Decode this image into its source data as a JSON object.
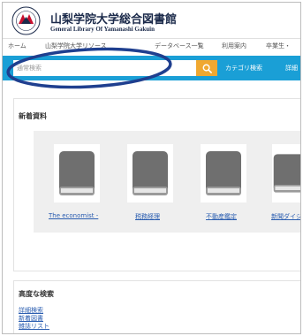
{
  "header": {
    "title_jp": "山梨学院大学総合図書館",
    "title_en": "General Library Of Yamanashi Gakuin"
  },
  "nav": {
    "items": [
      {
        "label": "ホーム"
      },
      {
        "label": "山梨学院大学リソース"
      },
      {
        "label": "データベース一覧"
      },
      {
        "label": "利用案内"
      },
      {
        "label": "卒業生・"
      }
    ]
  },
  "search": {
    "placeholder": "通常検索",
    "category_label": "カテゴリ検索",
    "detail_label": "詳細"
  },
  "new_items": {
    "title": "新着資料",
    "books": [
      {
        "label": "The economist -"
      },
      {
        "label": "税務経理"
      },
      {
        "label": "不動産鑑定"
      },
      {
        "label": "新聞ダイジェ"
      }
    ]
  },
  "advanced": {
    "title": "高度な検索",
    "links": [
      {
        "label": "詳細検索"
      },
      {
        "label": "新着図書"
      },
      {
        "label": "雑誌リスト"
      }
    ]
  },
  "colors": {
    "accent": "#1a9fd6",
    "search_button": "#f0a830",
    "annotation": "#1f3f8f",
    "link": "#2a5db0"
  }
}
